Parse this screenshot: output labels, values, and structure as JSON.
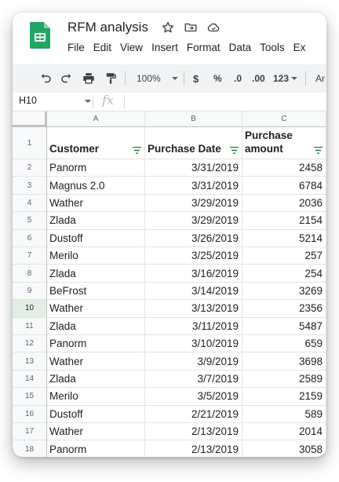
{
  "doc": {
    "title": "RFM analysis"
  },
  "menu": [
    "File",
    "Edit",
    "View",
    "Insert",
    "Format",
    "Data",
    "Tools",
    "Ex"
  ],
  "toolbar": {
    "zoom": "100%",
    "currency": "$",
    "percent": "%",
    "decrease_decimals": ".0",
    "increase_decimals": ".00",
    "more_formats": "123",
    "font_partial": "Ar"
  },
  "formula_bar": {
    "cell_ref": "H10",
    "fx_label": "fx",
    "value": ""
  },
  "columns": [
    "A",
    "B",
    "C"
  ],
  "header_row": {
    "row_number": "1",
    "customer": "Customer",
    "purchase_date": "Purchase Date",
    "purchase_amount_line1": "Purchase",
    "purchase_amount_line2": "amount"
  },
  "rows": [
    {
      "n": "2",
      "customer": "Panorm",
      "date": "3/31/2019",
      "amount": "2458"
    },
    {
      "n": "3",
      "customer": "Magnus 2.0",
      "date": "3/31/2019",
      "amount": "6784"
    },
    {
      "n": "4",
      "customer": "Wather",
      "date": "3/29/2019",
      "amount": "2036"
    },
    {
      "n": "5",
      "customer": "Zlada",
      "date": "3/29/2019",
      "amount": "2154"
    },
    {
      "n": "6",
      "customer": "Dustoff",
      "date": "3/26/2019",
      "amount": "5214"
    },
    {
      "n": "7",
      "customer": "Merilo",
      "date": "3/25/2019",
      "amount": "257"
    },
    {
      "n": "8",
      "customer": "Zlada",
      "date": "3/16/2019",
      "amount": "254"
    },
    {
      "n": "9",
      "customer": "BeFrost",
      "date": "3/14/2019",
      "amount": "3269"
    },
    {
      "n": "10",
      "customer": "Wather",
      "date": "3/13/2019",
      "amount": "2356"
    },
    {
      "n": "11",
      "customer": "Zlada",
      "date": "3/11/2019",
      "amount": "5487"
    },
    {
      "n": "12",
      "customer": "Panorm",
      "date": "3/10/2019",
      "amount": "659"
    },
    {
      "n": "13",
      "customer": "Wather",
      "date": "3/9/2019",
      "amount": "3698"
    },
    {
      "n": "14",
      "customer": "Zlada",
      "date": "3/7/2019",
      "amount": "2589"
    },
    {
      "n": "15",
      "customer": "Merilo",
      "date": "3/5/2019",
      "amount": "2159"
    },
    {
      "n": "16",
      "customer": "Dustoff",
      "date": "2/21/2019",
      "amount": "589"
    },
    {
      "n": "17",
      "customer": "Wather",
      "date": "2/13/2019",
      "amount": "2014"
    },
    {
      "n": "18",
      "customer": "Panorm",
      "date": "2/13/2019",
      "amount": "3058"
    }
  ],
  "selected_row": "10",
  "colors": {
    "sheets_green": "#23a566",
    "filter_green": "#188038",
    "selected_row_bg": "#e1eee6"
  },
  "icons": [
    "sheets-logo",
    "star-icon",
    "move-to-folder-icon",
    "cloud-status-icon",
    "undo-icon",
    "redo-icon",
    "print-icon",
    "paint-format-icon",
    "filter-icon"
  ]
}
